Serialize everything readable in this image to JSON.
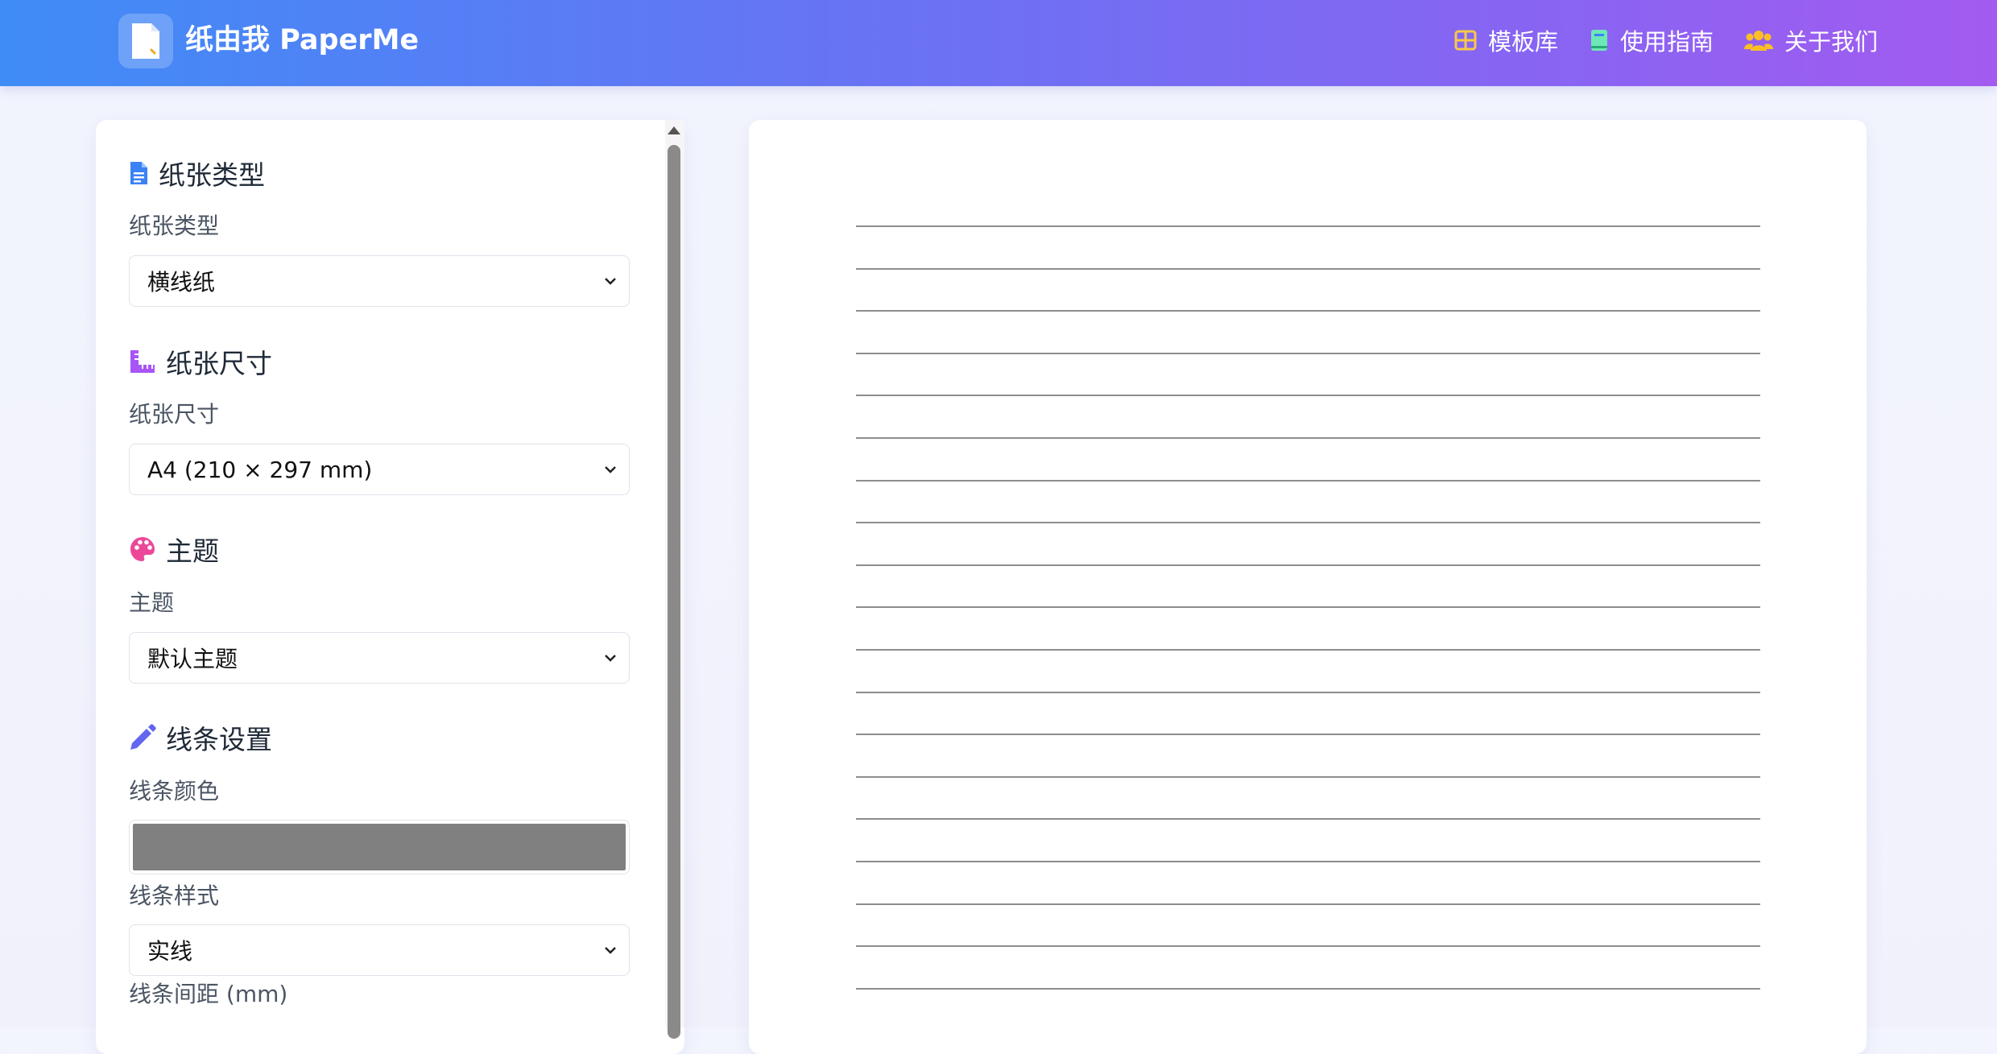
{
  "header": {
    "brand": "纸由我 PaperMe",
    "nav": [
      {
        "label": "模板库",
        "icon": "grid-icon",
        "color": "#f7c948"
      },
      {
        "label": "使用指南",
        "icon": "book-icon",
        "color": "#6ee7b7"
      },
      {
        "label": "关于我们",
        "icon": "users-icon",
        "color": "#fbbf24"
      }
    ]
  },
  "sidebar": {
    "paper_type": {
      "section": "纸张类型",
      "label": "纸张类型",
      "value": "横线纸"
    },
    "paper_size": {
      "section": "纸张尺寸",
      "label": "纸张尺寸",
      "value": "A4 (210 × 297 mm)"
    },
    "theme": {
      "section": "主题",
      "label": "主题",
      "value": "默认主题"
    },
    "line_settings": {
      "section": "线条设置",
      "color_label": "线条颜色",
      "color_value": "#808080",
      "style_label": "线条样式",
      "style_value": "实线",
      "spacing_label": "线条间距 (mm)"
    }
  },
  "preview": {
    "line_count": 19,
    "line_color": "#8d8d8d"
  },
  "colors": {
    "accent_blue": "#3f8cf7",
    "accent_purple": "#a35bf0",
    "ruler_icon": "#a855f7",
    "palette_icon": "#ec4899",
    "pencil_icon": "#6366f1",
    "file_icon": "#3b82f6"
  }
}
